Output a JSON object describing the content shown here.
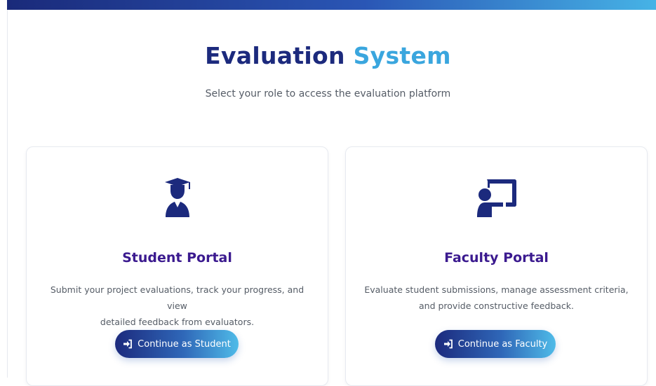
{
  "page": {
    "title_part1": "Evaluation",
    "title_part2": "System",
    "subtitle": "Select your role to access the evaluation platform"
  },
  "cards": [
    {
      "icon": "user-graduate-icon",
      "title": "Student Portal",
      "description_line1": "Submit your project evaluations, track your progress, and view",
      "description_line2": "detailed feedback from evaluators.",
      "button_label": "Continue as Student"
    },
    {
      "icon": "chalkboard-teacher-icon",
      "title": "Faculty Portal",
      "description_line1": "Evaluate student submissions, manage assessment criteria,",
      "description_line2": "and provide constructive feedback.",
      "button_label": "Continue as Faculty"
    }
  ],
  "colors": {
    "primary_dark": "#1c2a7d",
    "accent_light": "#3aa6de",
    "card_title": "#3b1a8f",
    "icon": "#1c2a7d"
  }
}
